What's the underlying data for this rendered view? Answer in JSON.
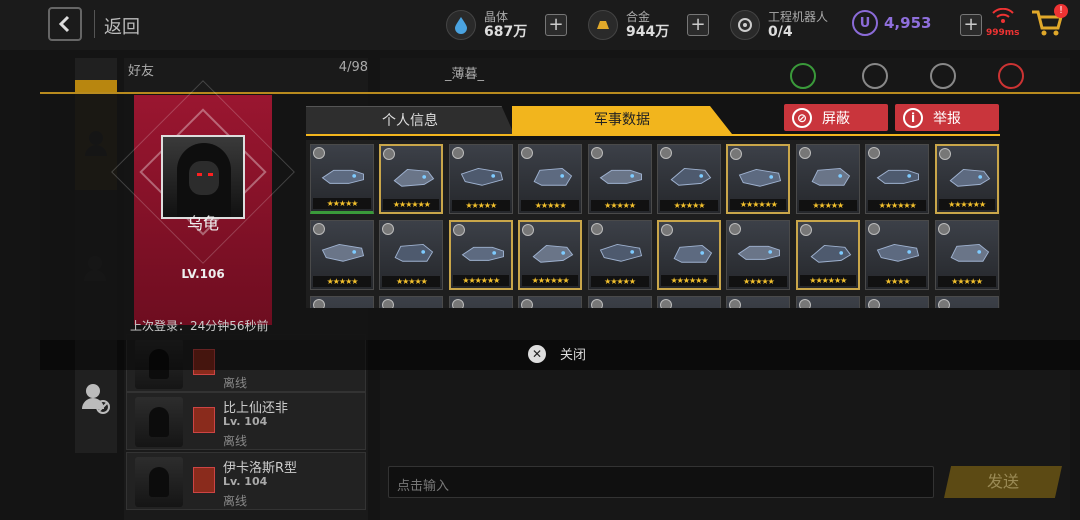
{
  "topbar": {
    "back_label": "返回",
    "resources": [
      {
        "label": "晶体",
        "value": "687万",
        "icon": "crystal-icon"
      },
      {
        "label": "合金",
        "value": "944万",
        "icon": "alloy-icon"
      },
      {
        "label": "工程机器人",
        "value": "0/4",
        "icon": "robot-icon"
      }
    ],
    "credits": {
      "symbol": "U",
      "value": "4,953"
    },
    "ping": "999ms",
    "cart_badge": "!"
  },
  "background": {
    "friends_label": "好友",
    "friends_count": "4/98",
    "friends": [
      {
        "name": "",
        "level": "",
        "status": "离线"
      },
      {
        "name": "比上仙还非",
        "level": "Lv. 104",
        "status": "离线"
      },
      {
        "name": "伊卡洛斯R型",
        "level": "Lv. 104",
        "status": "离线"
      }
    ],
    "chat_name": "_薄暮_",
    "chat_placeholder": "点击输入",
    "send_label": "发送"
  },
  "profile": {
    "name": "乌龟",
    "level": "LV.106",
    "last_login": "上次登录：24分钟56秒前"
  },
  "tabs": {
    "personal": "个人信息",
    "military": "军事数据"
  },
  "actions": {
    "block": "屏蔽",
    "report": "举报"
  },
  "ships": [
    {
      "stars": "★★★★★",
      "frame": "green"
    },
    {
      "stars": "★★★★★★",
      "frame": "gold"
    },
    {
      "stars": "★★★★★",
      "frame": "none"
    },
    {
      "stars": "★★★★★",
      "frame": "none"
    },
    {
      "stars": "★★★★★",
      "frame": "none"
    },
    {
      "stars": "★★★★★",
      "frame": "none"
    },
    {
      "stars": "★★★★★★",
      "frame": "gold"
    },
    {
      "stars": "★★★★★",
      "frame": "none"
    },
    {
      "stars": "★★★★★★",
      "frame": "none"
    },
    {
      "stars": "★★★★★★",
      "frame": "gold"
    },
    {
      "stars": "★★★★★",
      "frame": "none"
    },
    {
      "stars": "★★★★★",
      "frame": "none"
    },
    {
      "stars": "★★★★★★",
      "frame": "gold"
    },
    {
      "stars": "★★★★★★",
      "frame": "gold"
    },
    {
      "stars": "★★★★★",
      "frame": "none"
    },
    {
      "stars": "★★★★★★",
      "frame": "gold"
    },
    {
      "stars": "★★★★★",
      "frame": "none"
    },
    {
      "stars": "★★★★★★",
      "frame": "gold"
    },
    {
      "stars": "★★★★",
      "frame": "none"
    },
    {
      "stars": "★★★★★",
      "frame": "none"
    }
  ],
  "close_label": "关闭"
}
